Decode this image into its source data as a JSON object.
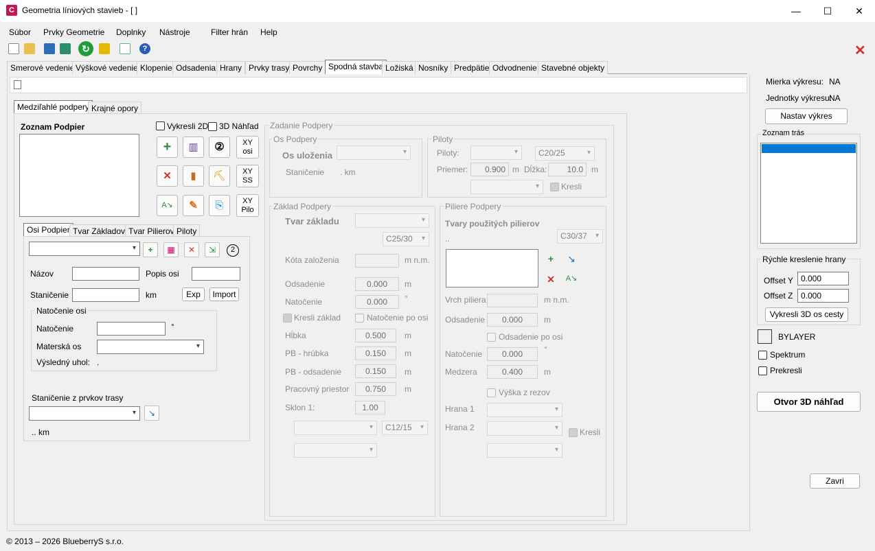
{
  "window": {
    "title": "Geometria líniových stavieb - [ ]",
    "app_glyph": "C"
  },
  "menu": [
    "Súbor",
    "Prvky Geometrie",
    "Doplnky",
    "Nástroje",
    "Filter hrán",
    "Help"
  ],
  "main_tabs": [
    "Smerové vedenie",
    "Výškové vedenie",
    "Klopenie",
    "Odsadenia",
    "Hrany",
    "Prvky trasy",
    "Povrchy",
    "Spodná stavba",
    "Ložiská",
    "Nosníky",
    "Predpätie",
    "Odvodnenie",
    "Stavebné objekty"
  ],
  "sub_tabs": [
    "Medziľahlé podpery",
    "Krajné opory"
  ],
  "left": {
    "list_title": "Zoznam Podpier",
    "chk_2d": "Vykresli 2D",
    "chk_3d": "3D Náhľad",
    "xy_osi": [
      "XY",
      "osi"
    ],
    "xy_ss": [
      "XY",
      "SS"
    ],
    "xy_pilo": [
      "XY",
      "Pilo"
    ],
    "inner_tabs": [
      "Osi Podpier",
      "Tvar Základov",
      "Tvar Pilierov",
      "Piloty"
    ],
    "nazov": "Názov",
    "popis_osi": "Popis osi",
    "stanicenie": "Staničenie",
    "km": "km",
    "exp": "Exp",
    "import": "Import",
    "natocenie_group": "Natočenie osi",
    "natocenie": "Natočenie",
    "deg": "°",
    "materska_os": "Materská os",
    "vysledny_uhol": "Výsledný uhol:",
    "vysledny_val": ".",
    "stanicenie_prvkov": "Staničenie z prvkov trasy",
    "km_readout": ".. km"
  },
  "zadanie": {
    "title": "Zadanie Podpery",
    "os_group": "Os Podpery",
    "os_ulozenia": "Os uloženia",
    "stanicenie": "Staničenie",
    "stanicenie_val": ". km",
    "piloty_group": "Piloty",
    "piloty": "Piloty:",
    "c20": "C20/25",
    "priemer": "Priemer:",
    "priemer_val": "0.900",
    "m": "m",
    "dlzka": "Dĺžka:",
    "dlzka_val": "10.0",
    "kresli": "Kresli",
    "zaklad_group": "Základ Podpery",
    "tvar_zakladu": "Tvar základu",
    "c25": "C25/30",
    "kota": "Kóta založenia",
    "mnm": "m n.m.",
    "odsadenie": "Odsadenie",
    "odsadenie_val": "0.000",
    "natocenie": "Natočenie",
    "natocenie_val": "0.000",
    "deg": "°",
    "kresli_zaklad": "Kresli základ",
    "natocenie_po_osi": "Natočenie po osi",
    "hlbka": "Hĺbka",
    "hlbka_val": "0.500",
    "pb_hrubka": "PB - hrúbka",
    "pb_hrubka_val": "0.150",
    "pb_odsadenie": "PB - odsadenie",
    "pb_odsadenie_val": "0.150",
    "pracovny": "Pracovný priestor",
    "pracovny_val": "0.750",
    "sklon": "Sklon 1:",
    "sklon_val": "1.00",
    "c12": "C12/15",
    "piliere_group": "Piliere Podpery",
    "tvary": "Tvary použitých pilierov",
    "dots": "..",
    "c30": "C30/37",
    "vrch": "Vrch piliera",
    "p_odsadenie_val": "0.000",
    "odsadenie_po_osi": "Odsadenie po osi",
    "p_natocenie_val": "0.000",
    "medzera": "Medzera",
    "medzera_val": "0.400",
    "vyska_z_rezov": "Výška z rezov",
    "hrana1": "Hrana 1",
    "hrana2": "Hrana 2"
  },
  "right": {
    "mierka": "Mierka výkresu:",
    "mierka_val": "NA",
    "jednotky": "Jednotky výkresu:",
    "jednotky_val": "NA",
    "nastav": "Nastav výkres",
    "zoznam_tras": "Zoznam trás",
    "rychle": "Rýchle kreslenie hrany",
    "offset_y": "Offset Y",
    "offset_y_val": "0.000",
    "offset_z": "Offset Z",
    "offset_z_val": "0.000",
    "vykresli3d": "Vykresli 3D os cesty",
    "bylayer": "BYLAYER",
    "spektrum": "Spektrum",
    "prekresli": "Prekresli",
    "otvor": "Otvor 3D náhľad",
    "zavri": "Zavri"
  },
  "status": "© 2013 – 2026 BlueberryS s.r.o.",
  "colors": {
    "accent": "#0078d7",
    "close_red": "#d32f2f"
  }
}
